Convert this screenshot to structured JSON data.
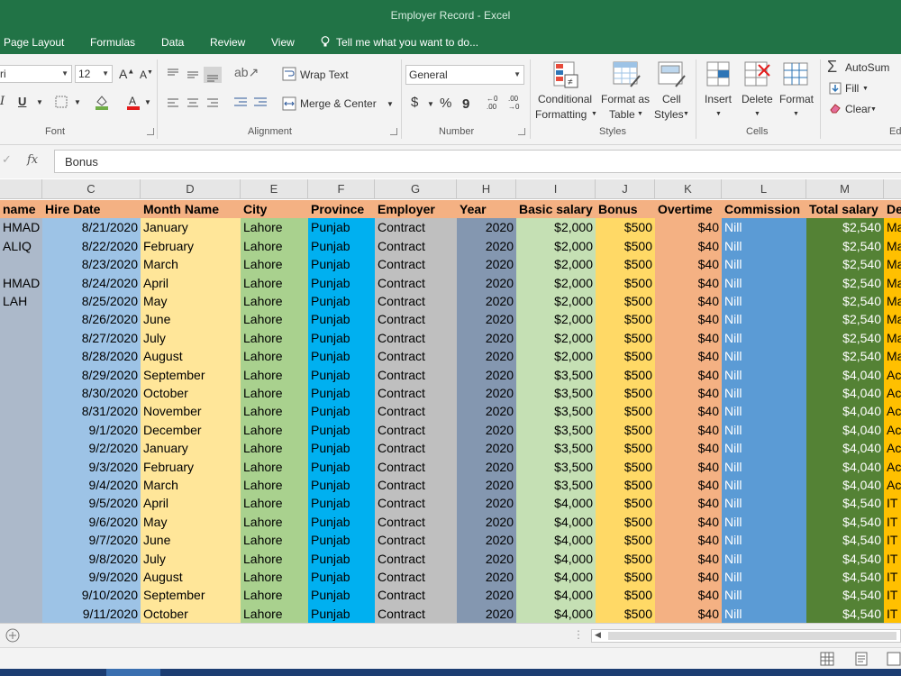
{
  "window": {
    "title": "Employer Record - Excel"
  },
  "tabs": [
    "Page Layout",
    "Formulas",
    "Data",
    "Review",
    "View"
  ],
  "tell_me": "Tell me what you want to do...",
  "ribbon": {
    "font": {
      "name": "ri",
      "size": "12",
      "group": "Font",
      "bold": "I",
      "underline": "U"
    },
    "alignment": {
      "wrap_text": "Wrap Text",
      "merge_center": "Merge & Center",
      "group": "Alignment"
    },
    "number": {
      "format": "General",
      "currency": "$",
      "percent": "%",
      "group": "Number"
    },
    "styles": {
      "conditional_1": "Conditional",
      "conditional_2": "Formatting",
      "format_as_1": "Format as",
      "format_as_2": "Table",
      "cell_1": "Cell",
      "cell_2": "Styles",
      "group": "Styles"
    },
    "cells": {
      "insert": "Insert",
      "delete": "Delete",
      "format": "Format",
      "group": "Cells"
    },
    "editing": {
      "autosum": "AutoSum",
      "fill": "Fill",
      "clear": "Clear",
      "group": "Ed"
    }
  },
  "formula_bar": {
    "fx": "fx",
    "value": "Bonus"
  },
  "columns": [
    "",
    "C",
    "D",
    "E",
    "F",
    "G",
    "H",
    "I",
    "J",
    "K",
    "L",
    "M",
    ""
  ],
  "headers": [
    "name",
    "Hire Date",
    "Month Name",
    "City",
    "Province",
    "Employer",
    "Year",
    "Basic salary",
    "Bonus",
    "Overtime",
    "Commission",
    "Total salary",
    "De"
  ],
  "rows": [
    [
      "HMAD",
      "8/21/2020",
      "January",
      "Lahore",
      "Punjab",
      "Contract",
      "2020",
      "$2,000",
      "$500",
      "$40",
      "Nill",
      "$2,540",
      "Ma"
    ],
    [
      "ALIQ",
      "8/22/2020",
      "February",
      "Lahore",
      "Punjab",
      "Contract",
      "2020",
      "$2,000",
      "$500",
      "$40",
      "Nill",
      "$2,540",
      "Ma"
    ],
    [
      "",
      "8/23/2020",
      "March",
      "Lahore",
      "Punjab",
      "Contract",
      "2020",
      "$2,000",
      "$500",
      "$40",
      "Nill",
      "$2,540",
      "Ma"
    ],
    [
      "HMAD",
      "8/24/2020",
      "April",
      "Lahore",
      "Punjab",
      "Contract",
      "2020",
      "$2,000",
      "$500",
      "$40",
      "Nill",
      "$2,540",
      "Ma"
    ],
    [
      "LAH",
      "8/25/2020",
      "May",
      "Lahore",
      "Punjab",
      "Contract",
      "2020",
      "$2,000",
      "$500",
      "$40",
      "Nill",
      "$2,540",
      "Ma"
    ],
    [
      "",
      "8/26/2020",
      "June",
      "Lahore",
      "Punjab",
      "Contract",
      "2020",
      "$2,000",
      "$500",
      "$40",
      "Nill",
      "$2,540",
      "Ma"
    ],
    [
      "",
      "8/27/2020",
      "July",
      "Lahore",
      "Punjab",
      "Contract",
      "2020",
      "$2,000",
      "$500",
      "$40",
      "Nill",
      "$2,540",
      "Ma"
    ],
    [
      "",
      "8/28/2020",
      "August",
      "Lahore",
      "Punjab",
      "Contract",
      "2020",
      "$2,000",
      "$500",
      "$40",
      "Nill",
      "$2,540",
      "Ma"
    ],
    [
      "",
      "8/29/2020",
      "September",
      "Lahore",
      "Punjab",
      "Contract",
      "2020",
      "$3,500",
      "$500",
      "$40",
      "Nill",
      "$4,040",
      "Ac"
    ],
    [
      "",
      "8/30/2020",
      "October",
      "Lahore",
      "Punjab",
      "Contract",
      "2020",
      "$3,500",
      "$500",
      "$40",
      "Nill",
      "$4,040",
      "Ac"
    ],
    [
      "",
      "8/31/2020",
      "November",
      "Lahore",
      "Punjab",
      "Contract",
      "2020",
      "$3,500",
      "$500",
      "$40",
      "Nill",
      "$4,040",
      "Ac"
    ],
    [
      "",
      "9/1/2020",
      "December",
      "Lahore",
      "Punjab",
      "Contract",
      "2020",
      "$3,500",
      "$500",
      "$40",
      "Nill",
      "$4,040",
      "Ac"
    ],
    [
      "",
      "9/2/2020",
      "January",
      "Lahore",
      "Punjab",
      "Contract",
      "2020",
      "$3,500",
      "$500",
      "$40",
      "Nill",
      "$4,040",
      "Ac"
    ],
    [
      "",
      "9/3/2020",
      "February",
      "Lahore",
      "Punjab",
      "Contract",
      "2020",
      "$3,500",
      "$500",
      "$40",
      "Nill",
      "$4,040",
      "Ac"
    ],
    [
      "",
      "9/4/2020",
      "March",
      "Lahore",
      "Punjab",
      "Contract",
      "2020",
      "$3,500",
      "$500",
      "$40",
      "Nill",
      "$4,040",
      "Ac"
    ],
    [
      "",
      "9/5/2020",
      "April",
      "Lahore",
      "Punjab",
      "Contract",
      "2020",
      "$4,000",
      "$500",
      "$40",
      "Nill",
      "$4,540",
      "IT"
    ],
    [
      "",
      "9/6/2020",
      "May",
      "Lahore",
      "Punjab",
      "Contract",
      "2020",
      "$4,000",
      "$500",
      "$40",
      "Nill",
      "$4,540",
      "IT"
    ],
    [
      "",
      "9/7/2020",
      "June",
      "Lahore",
      "Punjab",
      "Contract",
      "2020",
      "$4,000",
      "$500",
      "$40",
      "Nill",
      "$4,540",
      "IT"
    ],
    [
      "",
      "9/8/2020",
      "July",
      "Lahore",
      "Punjab",
      "Contract",
      "2020",
      "$4,000",
      "$500",
      "$40",
      "Nill",
      "$4,540",
      "IT"
    ],
    [
      "",
      "9/9/2020",
      "August",
      "Lahore",
      "Punjab",
      "Contract",
      "2020",
      "$4,000",
      "$500",
      "$40",
      "Nill",
      "$4,540",
      "IT"
    ],
    [
      "",
      "9/10/2020",
      "September",
      "Lahore",
      "Punjab",
      "Contract",
      "2020",
      "$4,000",
      "$500",
      "$40",
      "Nill",
      "$4,540",
      "IT"
    ],
    [
      "",
      "9/11/2020",
      "October",
      "Lahore",
      "Punjab",
      "Contract",
      "2020",
      "$4,000",
      "$500",
      "$40",
      "Nill",
      "$4,540",
      "IT"
    ]
  ],
  "colors": {
    "excel_green": "#217346",
    "header_fill": "#f4b183",
    "col_name": "#acb9ca",
    "col_hire_date": "#9dc3e6",
    "col_month": "#ffe699",
    "col_city": "#a9d18e",
    "col_province": "#00b0f0",
    "col_employer": "#bfbfbf",
    "col_year": "#8497b0",
    "col_basic": "#c5e0b4",
    "col_bonus": "#ffd966",
    "col_overtime": "#f4b183",
    "col_commission": "#5b9bd5",
    "col_total": "#548235",
    "col_dept": "#ffc000"
  }
}
